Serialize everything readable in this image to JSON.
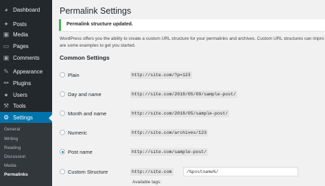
{
  "sidebar": {
    "items": [
      {
        "label": "Dashboard",
        "icon": "dashboard-icon"
      },
      {
        "label": "Posts",
        "icon": "pin-icon"
      },
      {
        "label": "Media",
        "icon": "media-icon"
      },
      {
        "label": "Pages",
        "icon": "page-icon"
      },
      {
        "label": "Comments",
        "icon": "comment-icon"
      },
      {
        "label": "Appearance",
        "icon": "brush-icon"
      },
      {
        "label": "Plugins",
        "icon": "plugin-icon"
      },
      {
        "label": "Users",
        "icon": "user-icon"
      },
      {
        "label": "Tools",
        "icon": "wrench-icon"
      },
      {
        "label": "Settings",
        "icon": "settings-icon"
      }
    ],
    "active": "Settings",
    "submenu": [
      "General",
      "Writing",
      "Reading",
      "Discussion",
      "Media",
      "Permalinks"
    ],
    "submenu_current": "Permalinks",
    "colors": {
      "background": "#23282d",
      "active": "#0073aa",
      "submenu": "#32373c"
    }
  },
  "page": {
    "title": "Permalink Settings",
    "notice": "Permalink structure updated.",
    "intro_line1": "WordPress offers you the ability to create a custom URL structure for your permalinks and archives. Custom URL structures can impro",
    "intro_line2": "are some examples to get you started.",
    "section_title": "Common Settings",
    "options": [
      {
        "label": "Plain",
        "example": "http://site.com/?p=123",
        "selected": false
      },
      {
        "label": "Day and name",
        "example": "http://site.com/2018/05/09/sample-post/",
        "selected": false
      },
      {
        "label": "Month and name",
        "example": "http://site.com/2018/05/sample-post/",
        "selected": false
      },
      {
        "label": "Numeric",
        "example": "http://site.com/archives/123",
        "selected": false
      },
      {
        "label": "Post name",
        "example": "http://site.com/sample-post/",
        "selected": true
      },
      {
        "label": "Custom Structure",
        "example": "http://site.com",
        "selected": false
      }
    ],
    "custom_structure_value": "/%postname%/",
    "available_tags": "Available tags:",
    "colors": {
      "notice_border": "#46b450",
      "radio_checked": "#1e8cbe"
    }
  }
}
